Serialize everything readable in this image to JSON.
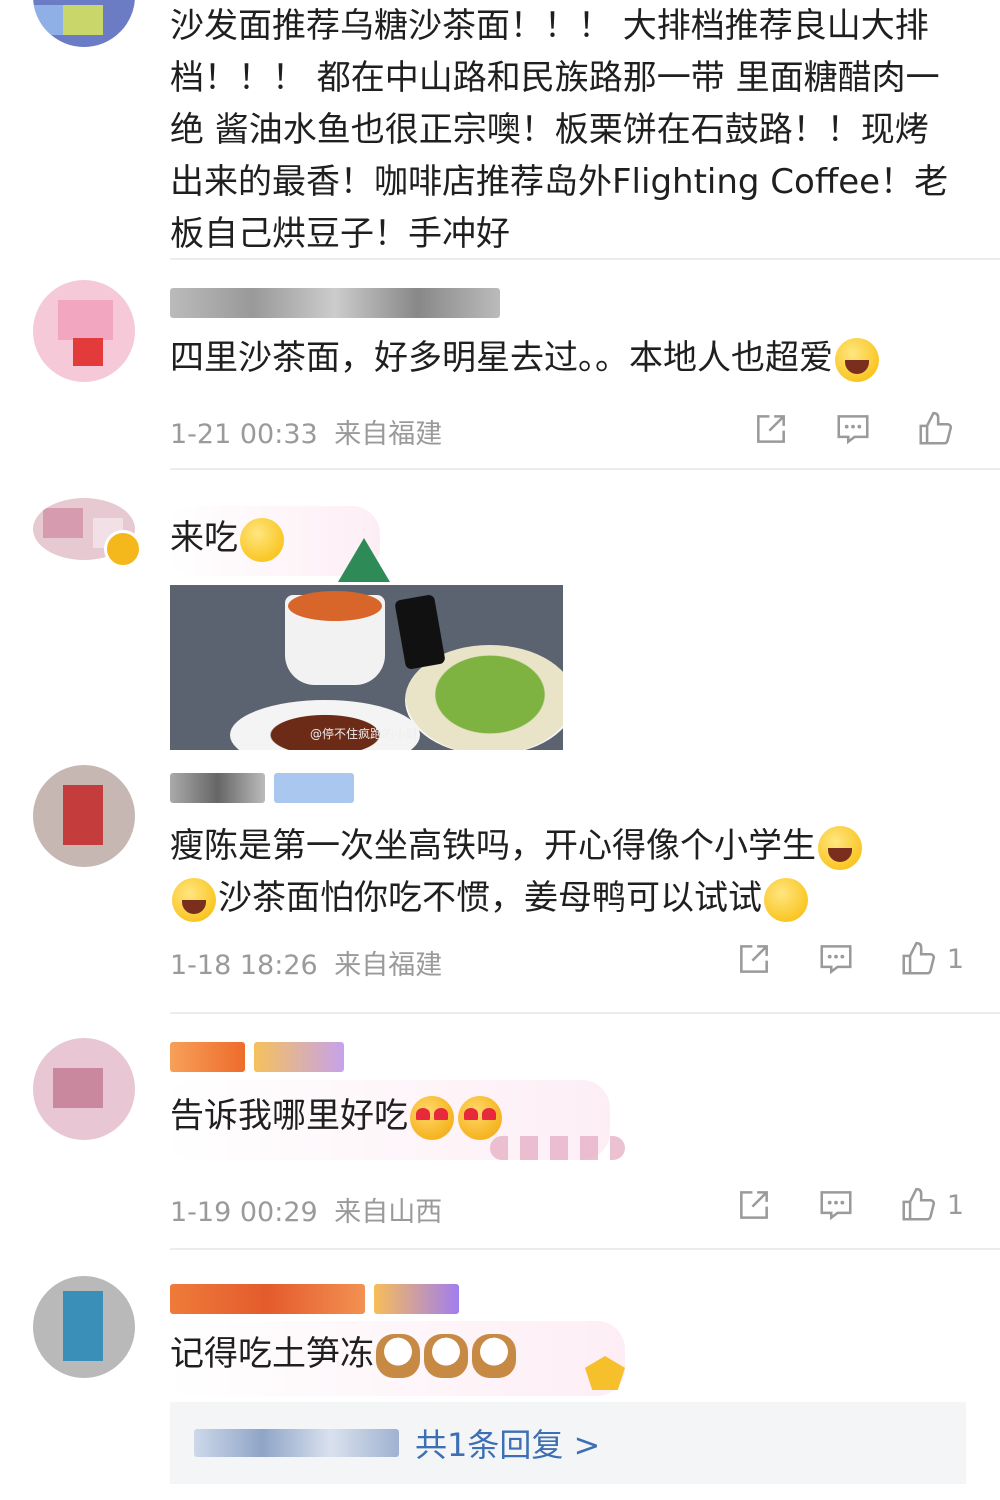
{
  "comments": [
    {
      "text": "沙发面推荐乌糖沙茶面！！！ 大排档推荐良山大排档！！！ 都在中山路和民族路那一带 里面糖醋肉一绝 酱油水鱼也很正宗噢！板栗饼在石鼓路！！现烤出来的最香！咖啡店推荐岛外Flighting Coffee！老板自己烘豆子！手冲好"
    },
    {
      "text": "四里沙茶面，好多明星去过。。本地人也超爱",
      "emoji": "crying-laugh-emoji",
      "time": "1-21 00:33",
      "location": "来自福建",
      "likes": ""
    },
    {
      "text": "来吃",
      "emoji": "dizzy-emoji",
      "image_watermark": "@停不住疯跑的小财"
    },
    {
      "text_line1": "瘦陈是第一次坐高铁吗，开心得像个小学生",
      "text_line2": "沙茶面怕你吃不惯，姜母鸭可以试试",
      "time": "1-18 18:26",
      "location": "来自福建",
      "likes": "1"
    },
    {
      "text": "告诉我哪里好吃",
      "time": "1-19 00:29",
      "location": "来自山西",
      "likes": "1"
    },
    {
      "text": "记得吃土笋冻",
      "reply_summary": "共1条回复 >"
    }
  ],
  "icons": {
    "share": "share-icon",
    "comment": "comment-icon",
    "like": "thumbs-up-icon"
  },
  "colors": {
    "meta_text": "#9a9a9a",
    "link": "#3d6fb4",
    "divider": "#ececec"
  }
}
